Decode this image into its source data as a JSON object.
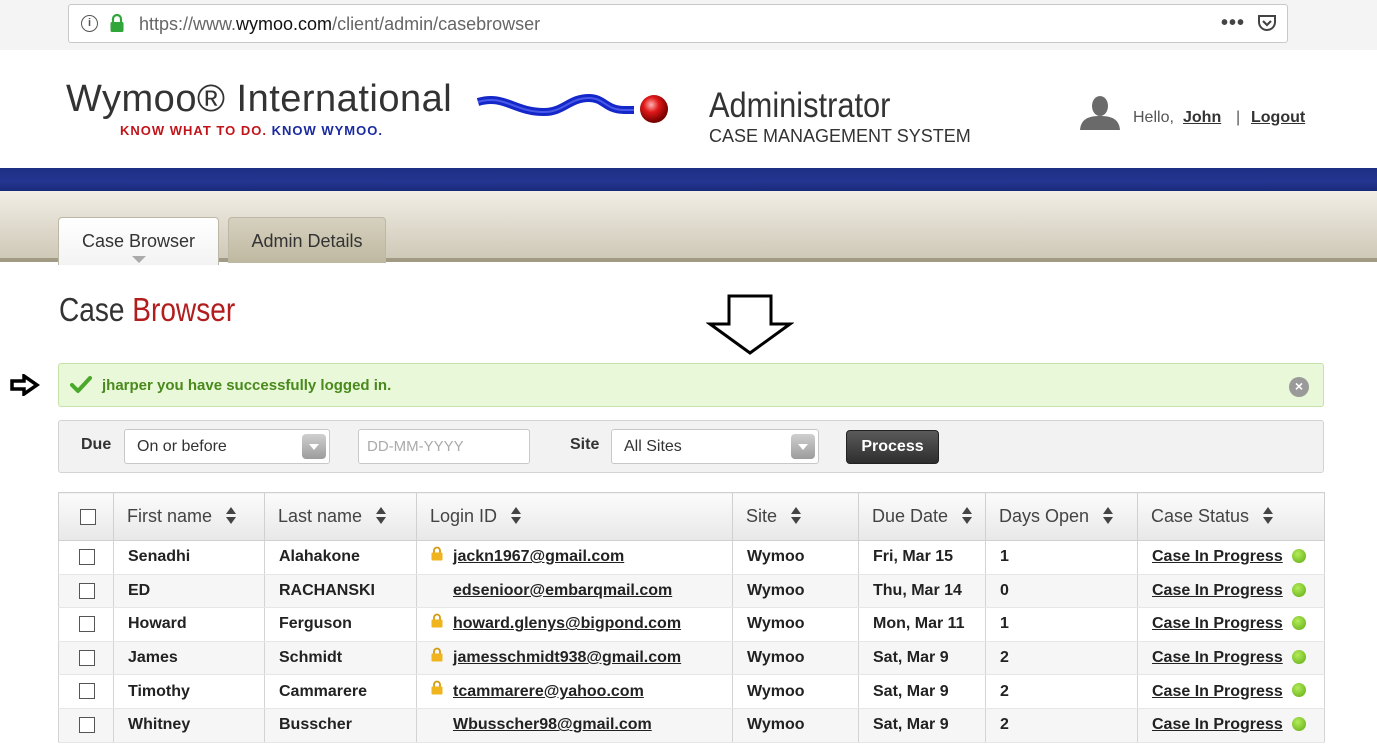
{
  "browser": {
    "url_prefix": "https://www.",
    "url_domain": "wymoo.com",
    "url_path": "/client/admin/casebrowser",
    "more_glyph": "•••"
  },
  "header": {
    "logo_wordmark": "Wymoo® International",
    "logo_tagline_part1": "KNOW WHAT TO DO.",
    "logo_tagline_part2": "KNOW WYMOO.",
    "app_title": "Administrator",
    "app_subtitle": "CASE MANAGEMENT SYSTEM",
    "hello_label": "Hello,",
    "user_name": "John",
    "separator": "|",
    "logout_label": "Logout"
  },
  "tabs": [
    {
      "label": "Case Browser",
      "active": true
    },
    {
      "label": "Admin Details",
      "active": false
    }
  ],
  "page": {
    "title_word1": "Case",
    "title_word2": "Browser"
  },
  "alert": {
    "message": "jharper you have successfully logged in.",
    "close_glyph": "×"
  },
  "filters": {
    "due_label": "Due",
    "due_option": "On or before",
    "date_placeholder": "DD-MM-YYYY",
    "site_label": "Site",
    "site_option": "All Sites",
    "process_label": "Process"
  },
  "table": {
    "columns": [
      "First name",
      "Last name",
      "Login ID",
      "Site",
      "Due Date",
      "Days Open",
      "Case Status"
    ],
    "rows": [
      {
        "first": "Senadhi",
        "last": "Alahakone",
        "login": "jackn1967@gmail.com",
        "locked": true,
        "site": "Wymoo",
        "due": "Fri, Mar 15",
        "days": "1",
        "status": "Case In Progress"
      },
      {
        "first": "ED",
        "last": "RACHANSKI",
        "login": "edsenioor@embarqmail.com",
        "locked": false,
        "site": "Wymoo",
        "due": "Thu, Mar 14",
        "days": "0",
        "status": "Case In Progress"
      },
      {
        "first": "Howard",
        "last": "Ferguson",
        "login": "howard.glenys@bigpond.com",
        "locked": true,
        "site": "Wymoo",
        "due": "Mon, Mar 11",
        "days": "1",
        "status": "Case In Progress"
      },
      {
        "first": "James",
        "last": "Schmidt",
        "login": "jamesschmidt938@gmail.com",
        "locked": true,
        "site": "Wymoo",
        "due": "Sat, Mar 9",
        "days": "2",
        "status": "Case In Progress"
      },
      {
        "first": "Timothy",
        "last": "Cammarere",
        "login": "tcammarere@yahoo.com",
        "locked": true,
        "site": "Wymoo",
        "due": "Sat, Mar 9",
        "days": "2",
        "status": "Case In Progress"
      },
      {
        "first": "Whitney",
        "last": "Busscher",
        "login": "Wbusscher98@gmail.com",
        "locked": false,
        "site": "Wymoo",
        "due": "Sat, Mar 9",
        "days": "2",
        "status": "Case In Progress"
      }
    ]
  },
  "colors": {
    "brand_blue": "#1d2f84",
    "accent_red": "#b21d1d",
    "success_green": "#4a8a1c",
    "status_green": "#5faa12"
  },
  "icons": {
    "info": "info-icon",
    "lock": "lock-icon",
    "pocket": "pocket-icon",
    "avatar": "user-avatar-icon",
    "check": "check-icon",
    "close": "close-icon",
    "sort": "sort-icon",
    "status": "status-dot-icon"
  }
}
